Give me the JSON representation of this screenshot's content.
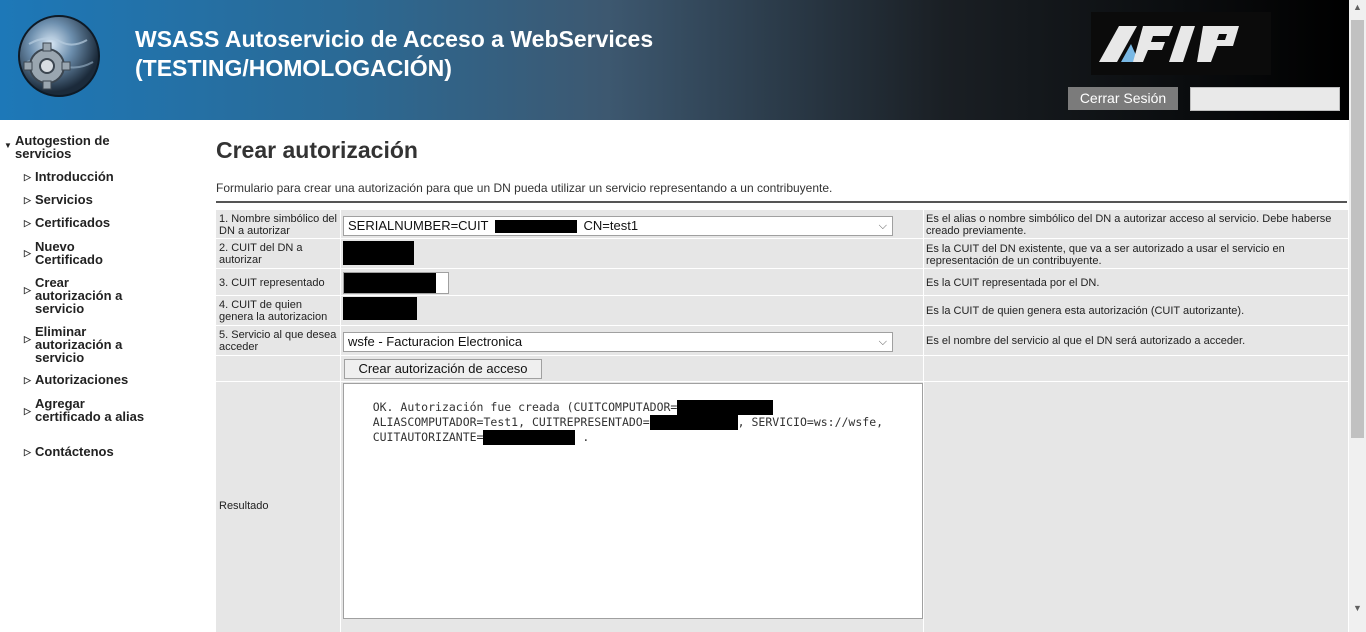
{
  "header": {
    "title_line1": "WSASS Autoservicio de Acceso a WebServices",
    "title_line2": "(TESTING/HOMOLOGACIÓN)",
    "logo_text": "AFIP",
    "logout_label": "Cerrar Sesión",
    "user_field": ""
  },
  "sidebar": {
    "root": "Autogestion de servicios",
    "items": [
      {
        "label": "Introducción"
      },
      {
        "label": "Servicios"
      },
      {
        "label": "Certificados"
      },
      {
        "label": "Nuevo Certificado"
      },
      {
        "label": "Crear autorización a servicio"
      },
      {
        "label": "Eliminar autorización a servicio"
      },
      {
        "label": "Autorizaciones"
      },
      {
        "label": "Agregar certificado a alias"
      },
      {
        "label": "Contáctenos"
      }
    ]
  },
  "main": {
    "title": "Crear autorización",
    "intro": "Formulario para crear una autorización para que un DN pueda utilizar un servicio representando a un contribuyente.",
    "rows": [
      {
        "label": "1. Nombre simbólico del DN a autorizar",
        "help": "Es el alias o nombre simbólico del DN a autorizar acceso al servicio. Debe haberse creado previamente."
      },
      {
        "label": "2. CUIT del DN a autorizar",
        "help": "Es la CUIT del DN existente, que va a ser autorizado a usar el servicio en representación de un contribuyente."
      },
      {
        "label": "3. CUIT representado",
        "help": "Es la CUIT representada por el DN."
      },
      {
        "label": "4. CUIT de quien genera la autorizacion",
        "help": "Es la CUIT de quien genera esta autorización (CUIT autorizante)."
      },
      {
        "label": "5. Servicio al que desea acceder",
        "help": "Es el nombre del servicio al que el DN será autorizado a acceder."
      }
    ],
    "dn_select_prefix": "SERIALNUMBER=CUIT",
    "dn_select_suffix": "CN=test1",
    "service_select": "wsfe - Facturacion Electronica",
    "submit_label": "Crear autorización de acceso",
    "result_label": "Resultado",
    "result_line1": "OK. Autorización fue creada (CUITCOMPUTADOR=",
    "result_line2a": "ALIASCOMPUTADOR=Test1, CUITREPRESENTADO=",
    "result_line2b": ", SERVICIO=ws://wsfe,",
    "result_line3a": "CUITAUTORIZANTE=",
    "result_line3b": "."
  }
}
